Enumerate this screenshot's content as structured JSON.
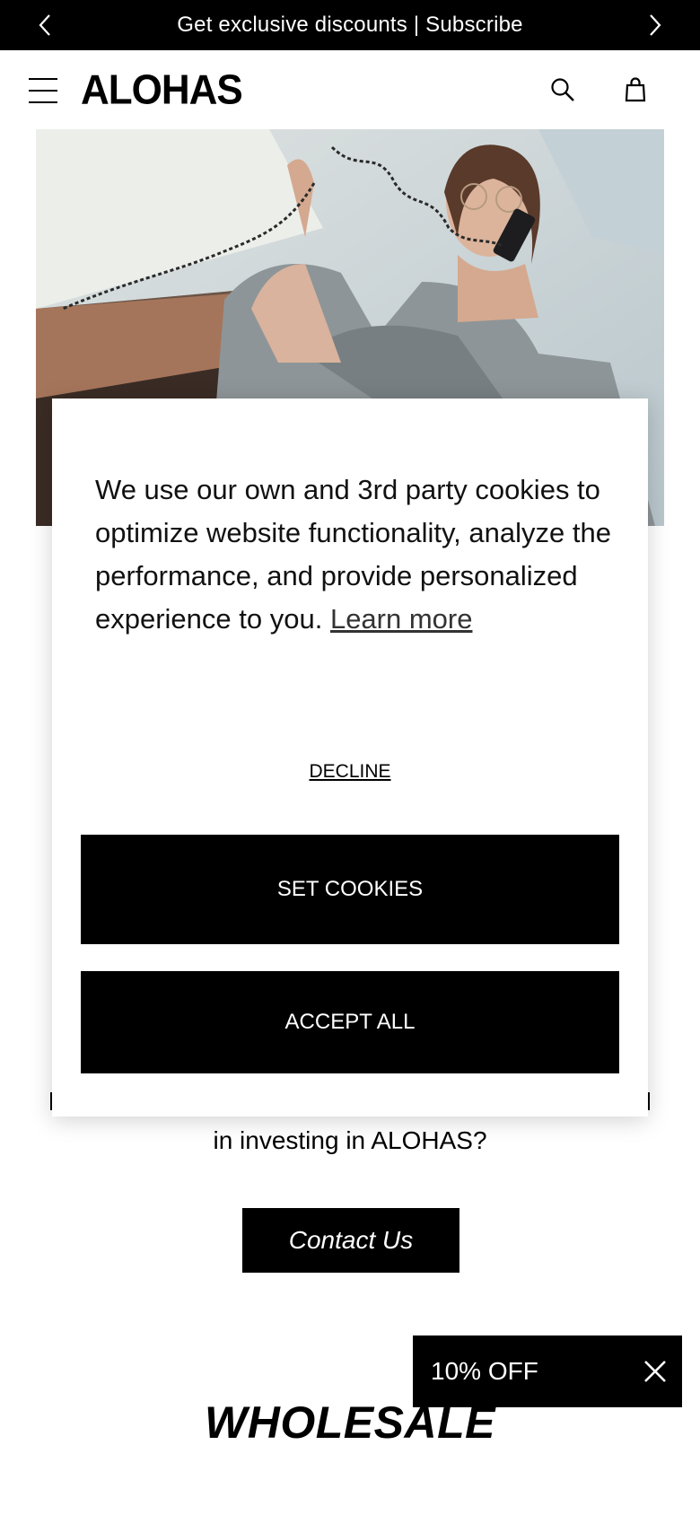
{
  "announcement": {
    "text": "Get exclusive discounts | Subscribe",
    "prev_icon": "chevron-left-icon",
    "next_icon": "chevron-right-icon"
  },
  "header": {
    "logo": "ALOHAS",
    "menu_icon": "hamburger-menu-icon",
    "search_icon": "search-icon",
    "bag_icon": "shopping-bag-icon"
  },
  "hero": {
    "description": "Woman with glasses talking on a corded telephone"
  },
  "main": {
    "investing_text": "in investing in ALOHAS?",
    "contact_label": "Contact Us",
    "wholesale_heading": "WHOLESALE"
  },
  "cookie_banner": {
    "message": "We use our own and 3rd party cookies to optimize website functionality, analyze the performance, and provide personalized experience to you.",
    "learn_more": "Learn more",
    "decline_label": "DECLINE",
    "set_cookies_label": "SET COOKIES",
    "accept_all_label": "ACCEPT ALL"
  },
  "discount_popup": {
    "label": "10% OFF",
    "close_icon": "close-icon"
  },
  "colors": {
    "primary": "#000000",
    "background": "#ffffff"
  }
}
